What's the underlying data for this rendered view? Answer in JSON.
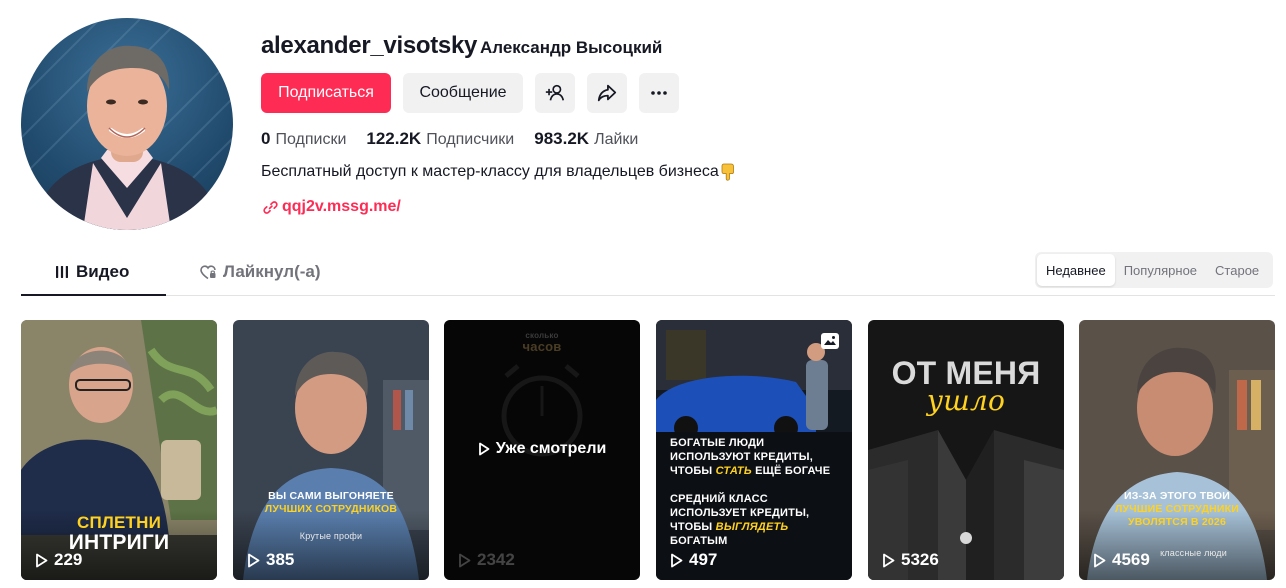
{
  "profile": {
    "username": "alexander_visotsky",
    "nickname": "Александр Высоцкий",
    "buttons": {
      "follow": "Подписаться",
      "message": "Сообщение"
    },
    "stats": [
      {
        "value": "0",
        "label": "Подписки"
      },
      {
        "value": "122.2K",
        "label": "Подписчики"
      },
      {
        "value": "983.2K",
        "label": "Лайки"
      }
    ],
    "bio": "Бесплатный доступ к мастер-классу для владельцев бизнеса",
    "link": "qqj2v.mssg.me/"
  },
  "tabs": {
    "videos": "Видео",
    "liked": "Лайкнул(-а)"
  },
  "sort": {
    "options": [
      "Недавнее",
      "Популярное",
      "Старое"
    ],
    "selected": "Недавнее"
  },
  "videos": [
    {
      "views": "229",
      "caption_lines": [
        "СПЛЕТНИ",
        "ИНТРИГИ"
      ]
    },
    {
      "views": "385",
      "caption_lines": [
        "ВЫ САМИ ВЫГОНЯЕТЕ",
        "ЛУЧШИХ СОТРУДНИКОВ"
      ],
      "subcaption": "Крутые профи"
    },
    {
      "views": "2342",
      "overlay": "Уже смотрели",
      "top_text": [
        "сколько",
        "часов"
      ]
    },
    {
      "views": "497",
      "caption_lines": [
        "БОГАТЫЕ ЛЮДИ",
        "ИСПОЛЬЗУЮТ КРЕДИТЫ,",
        "ЧТОБЫ",
        "СТАТЬ",
        "ЕЩЁ БОГАЧЕ",
        "СРЕДНИЙ КЛАСС",
        "ИСПОЛЬЗУЕТ КРЕДИТЫ,",
        "ЧТОБЫ",
        "ВЫГЛЯДЕТЬ",
        "БОГАТЫМ"
      ]
    },
    {
      "views": "5326",
      "caption_lines": [
        "ОТ МЕНЯ",
        "ушло"
      ]
    },
    {
      "views": "4569",
      "caption_lines": [
        "ИЗ-ЗА ЭТОГО ТВОИ",
        "ЛУЧШИЕ СОТРУДНИКИ",
        "УВОЛЯТСЯ В 2026"
      ],
      "subcaption": "классные люди"
    }
  ],
  "colors": {
    "accent": "#fe2c55",
    "caption_highlight": "#ffd21f"
  }
}
